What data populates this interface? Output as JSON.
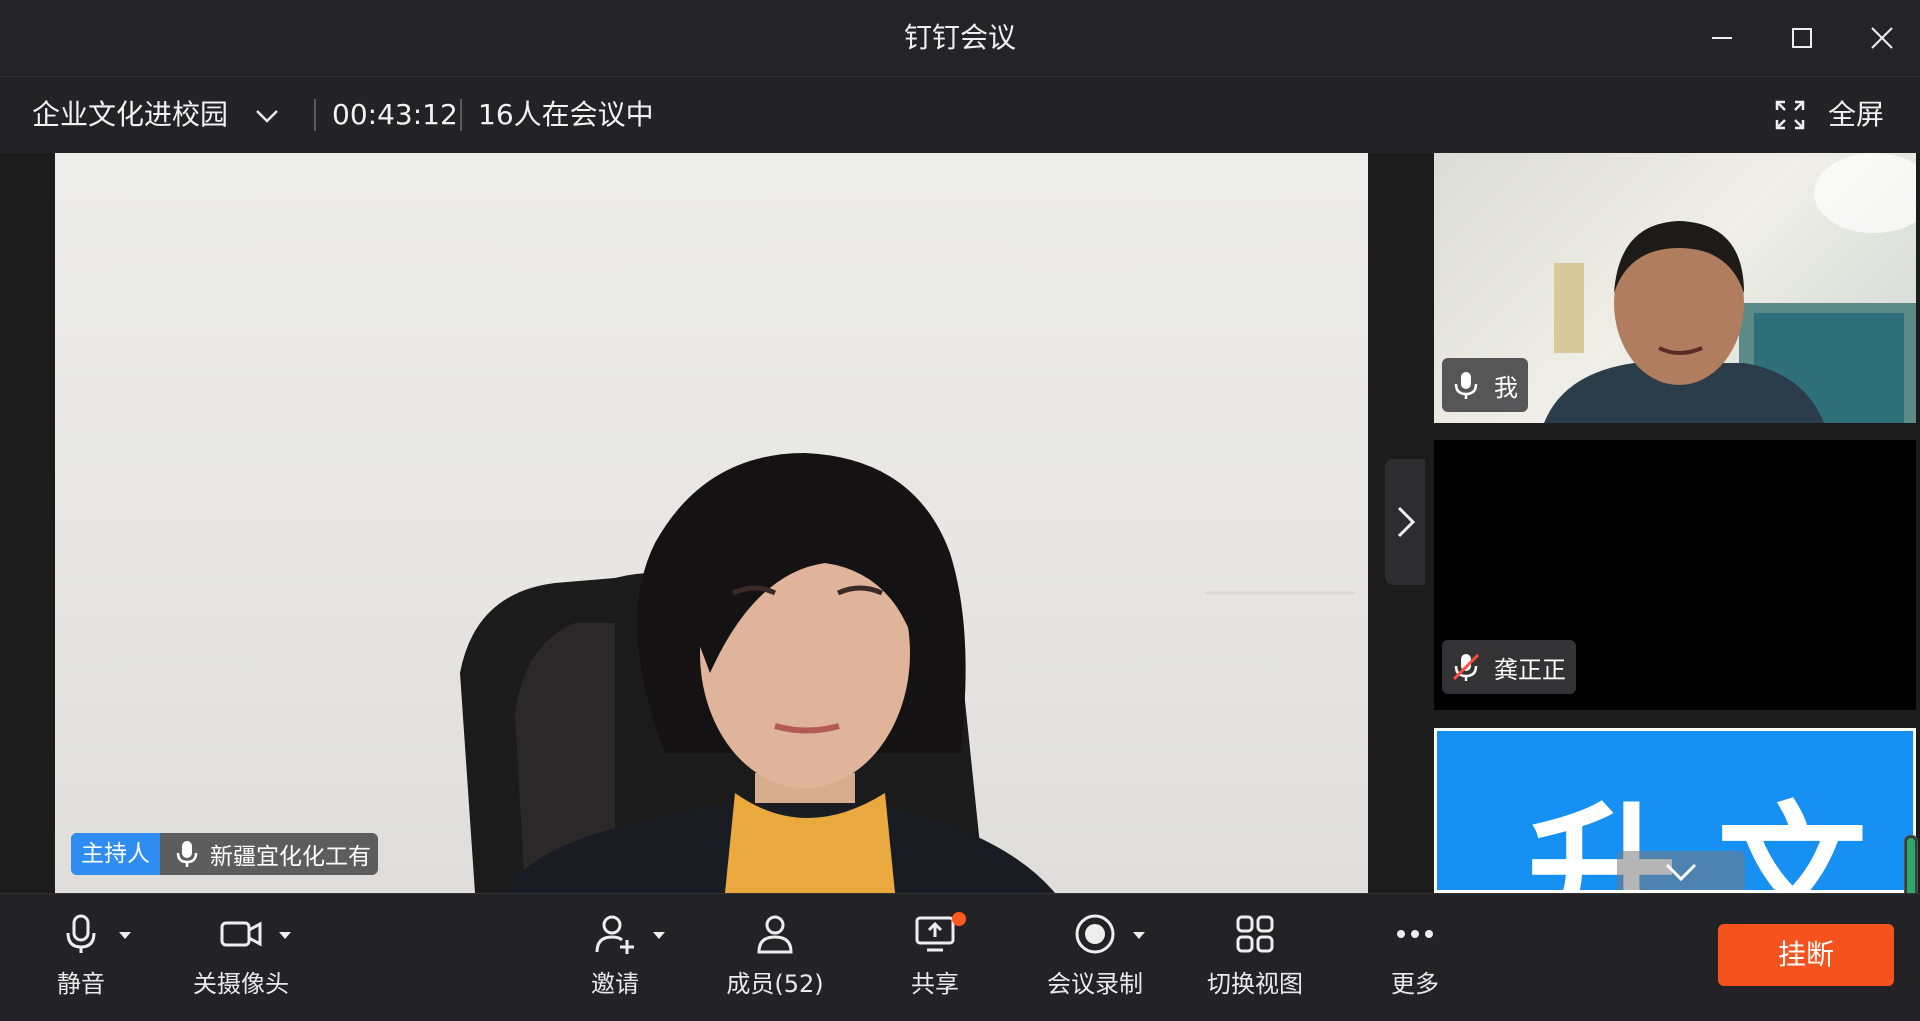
{
  "window": {
    "title": "钉钉会议"
  },
  "info_bar": {
    "meeting_name": "企业文化进校园",
    "elapsed_time": "00:43:12",
    "participant_count": "16人在会议中",
    "fullscreen_label": "全屏"
  },
  "main_video": {
    "host_badge": "主持人",
    "speaker_name": "新疆宜化化工有"
  },
  "side_tiles": [
    {
      "name": "我",
      "mic": "on"
    },
    {
      "name": "龚正正",
      "mic": "muted"
    },
    {
      "text": "升文"
    }
  ],
  "toolbar": {
    "mute_label": "静音",
    "camera_label": "关摄像头",
    "invite_label": "邀请",
    "members_label": "成员(52)",
    "share_label": "共享",
    "record_label": "会议录制",
    "switch_view_label": "切换视图",
    "more_label": "更多",
    "hangup_label": "挂断"
  },
  "colors": {
    "background": "#1e1e1f",
    "host_badge": "#2f8cf0",
    "hangup": "#f6521d",
    "notification_dot": "#ff5a1f",
    "tile3_background": "#1790f3",
    "muted_red": "#ff4d3d"
  }
}
